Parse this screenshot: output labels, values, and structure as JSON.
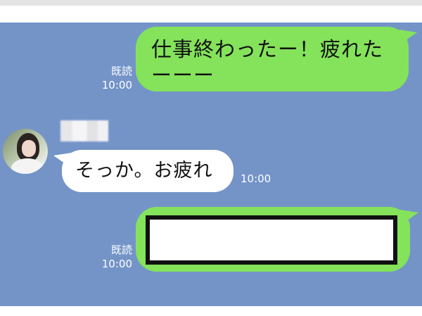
{
  "chat": {
    "background_color": "#7494c8",
    "messages": [
      {
        "direction": "outgoing",
        "text": "仕事終わったー！疲れたーーー",
        "read_label": "既読",
        "time": "10:00",
        "bubble_color": "#84e35a"
      },
      {
        "direction": "incoming",
        "text": "そっか。お疲れ",
        "time": "10:00",
        "bubble_color": "#ffffff"
      },
      {
        "direction": "outgoing",
        "text": "",
        "read_label": "既読",
        "time": "10:00",
        "bubble_color": "#84e35a",
        "content_hidden": true
      }
    ]
  },
  "icons": {
    "avatar": "profile-photo",
    "name": "blurred-name"
  }
}
